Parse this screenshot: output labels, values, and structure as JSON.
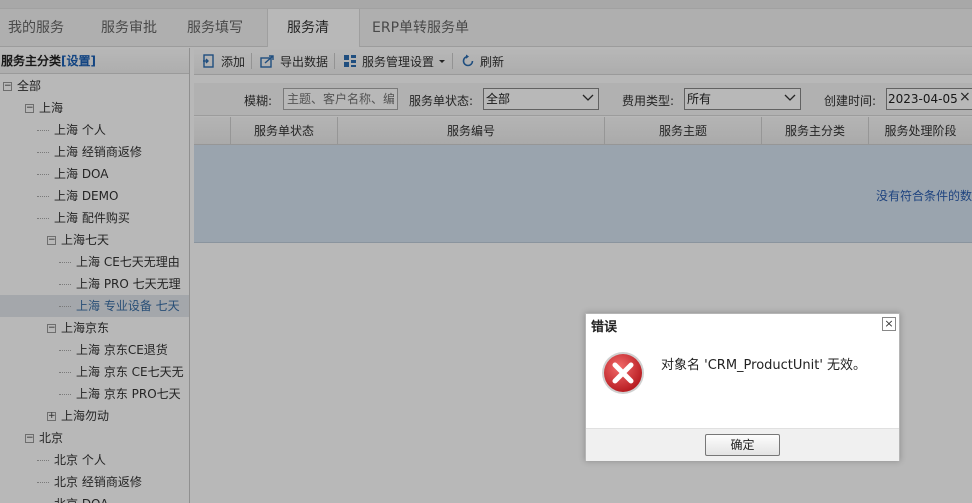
{
  "tabs": [
    {
      "label": "我的服务"
    },
    {
      "label": "服务审批"
    },
    {
      "label": "服务填写"
    },
    {
      "label": "服务清单",
      "active": true
    },
    {
      "label": "ERP单转服务单"
    }
  ],
  "left_panel": {
    "title": "服务主分类",
    "bracket_open": "[",
    "settings_link": "设置",
    "bracket_close": "]"
  },
  "tree": [
    {
      "label": "全部",
      "level": 0,
      "toggle": "−"
    },
    {
      "label": "上海",
      "level": 1,
      "toggle": "−"
    },
    {
      "label": "上海 个人",
      "level": 2
    },
    {
      "label": "上海 经销商返修",
      "level": 2
    },
    {
      "label": "上海 DOA",
      "level": 2
    },
    {
      "label": "上海 DEMO",
      "level": 2
    },
    {
      "label": "上海 配件购买",
      "level": 2
    },
    {
      "label": "上海七天",
      "level": 2,
      "toggle": "−"
    },
    {
      "label": "上海 CE七天无理由",
      "level": 3
    },
    {
      "label": "上海 PRO 七天无理",
      "level": 3
    },
    {
      "label": "上海 专业设备 七天",
      "level": 3,
      "selected": true
    },
    {
      "label": "上海京东",
      "level": 2,
      "toggle": "−"
    },
    {
      "label": "上海 京东CE退货",
      "level": 3
    },
    {
      "label": "上海 京东 CE七天无",
      "level": 3
    },
    {
      "label": "上海 京东 PRO七天",
      "level": 3
    },
    {
      "label": "上海勿动",
      "level": 2,
      "toggle": "+"
    },
    {
      "label": "北京",
      "level": 1,
      "toggle": "−"
    },
    {
      "label": "北京 个人",
      "level": 2
    },
    {
      "label": "北京 经销商返修",
      "level": 2
    },
    {
      "label": "北京 DOA",
      "level": 2
    }
  ],
  "toolbar": {
    "add": "添加",
    "export": "导出数据",
    "manage": "服务管理设置",
    "refresh": "刷新"
  },
  "filters": {
    "fuzzy_label": "模糊:",
    "fuzzy_placeholder": "主题、客户名称、编",
    "status_label": "服务单状态:",
    "status_value": "全部",
    "fee_label": "费用类型:",
    "fee_value": "所有",
    "created_label": "创建时间:",
    "created_value": "2023-04-05",
    "clear": "×"
  },
  "grid": {
    "columns": [
      "服务单状态",
      "服务编号",
      "服务主题",
      "服务主分类",
      "服务处理阶段"
    ],
    "empty_message": "没有符合条件的数"
  },
  "dialog": {
    "title": "错误",
    "close": "×",
    "message": "对象名 'CRM_ProductUnit' 无效。",
    "ok": "确定",
    "icon": "error-icon"
  },
  "colors": {
    "grid_body": "#d6e4f1",
    "link": "#1a5fb4",
    "error_red": "#d7262b"
  }
}
